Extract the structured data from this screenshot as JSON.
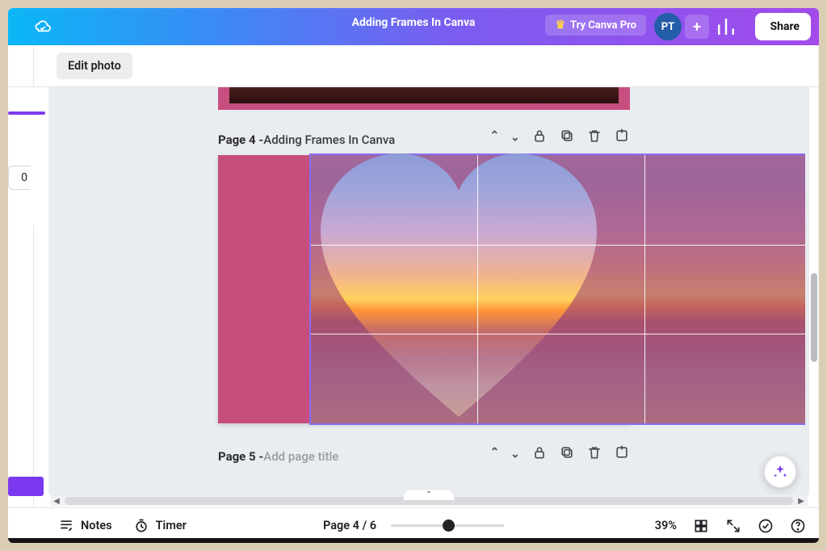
{
  "header": {
    "doc_title": "Adding Frames In Canva",
    "pro_label": "Try Canva Pro",
    "avatar_initials": "PT",
    "share_label": "Share"
  },
  "subtoolbar": {
    "edit_photo_label": "Edit photo"
  },
  "side": {
    "num_value": "0"
  },
  "pages": {
    "page4": {
      "label_prefix": "Page 4 - ",
      "title": "Adding Frames In Canva"
    },
    "page5": {
      "label_prefix": "Page 5 - ",
      "title_hint": "Add page title"
    }
  },
  "footer": {
    "notes_label": "Notes",
    "timer_label": "Timer",
    "page_indicator": "Page 4 / 6",
    "zoom_label": "39%"
  },
  "colors": {
    "accent": "#7b39ef",
    "gradient_start": "#0ab7f6",
    "gradient_end": "#a24bea"
  }
}
